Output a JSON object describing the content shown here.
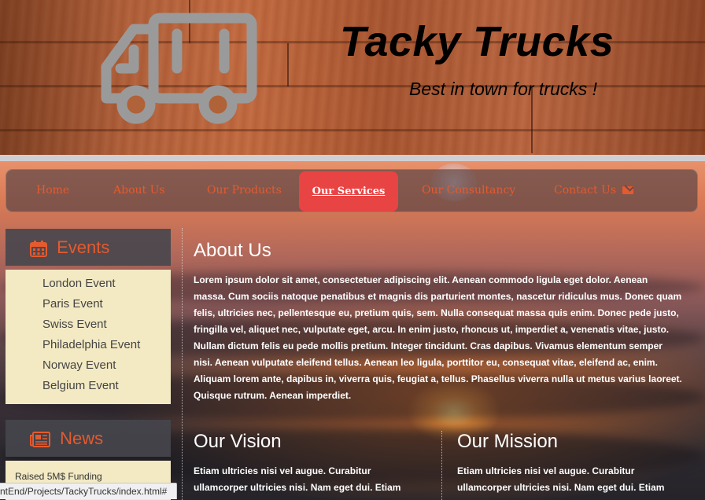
{
  "header": {
    "title": "Tacky Trucks",
    "tagline": "Best in town for trucks !",
    "logo_icon": "truck-icon"
  },
  "nav": {
    "items": [
      {
        "label": "Home"
      },
      {
        "label": "About Us"
      },
      {
        "label": "Our Products"
      },
      {
        "label": "Our Services",
        "active": true
      },
      {
        "label": "Our Consultancy"
      },
      {
        "label": "Contact Us",
        "icon": "envelope-icon"
      }
    ],
    "accent_color": "#e55a2e",
    "active_bg_color": "#e84444"
  },
  "sidebar": {
    "events": {
      "title": "Events",
      "icon": "calendar-icon",
      "items": [
        "London Event",
        "Paris Event",
        "Swiss Event",
        "Philadelphia Event",
        "Norway Event",
        "Belgium Event"
      ]
    },
    "news": {
      "title": "News",
      "icon": "newspaper-icon",
      "items": [
        "Raised 5M$ Funding"
      ]
    }
  },
  "main": {
    "about": {
      "heading": "About Us",
      "lines": [
        "Lorem ipsum dolor sit amet, consectetuer adipiscing elit. Aenean commodo ligula eget dolor. Aenean",
        "massa. Cum sociis natoque penatibus et magnis dis parturient montes, nascetur ridiculus mus. Donec quam",
        "felis, ultricies nec, pellentesque eu, pretium quis, sem. Nulla consequat massa quis enim. Donec pede justo,",
        "fringilla vel, aliquet nec, vulputate eget, arcu. In enim justo, rhoncus ut, imperdiet a, venenatis vitae, justo.",
        "Nullam dictum felis eu pede mollis pretium. Integer tincidunt. Cras dapibus. Vivamus elementum semper",
        "nisi. Aenean vulputate eleifend tellus. Aenean leo ligula, porttitor eu, consequat vitae, eleifend ac, enim.",
        "Aliquam lorem ante, dapibus in, viverra quis, feugiat a, tellus. Phasellus viverra nulla ut metus varius laoreet.",
        "Quisque rutrum. Aenean imperdiet."
      ]
    },
    "vision": {
      "heading": "Our Vision",
      "lines": [
        "Etiam ultricies nisi vel augue. Curabitur",
        "ullamcorper ultricies nisi. Nam eget dui. Etiam"
      ]
    },
    "mission": {
      "heading": "Our Mission",
      "lines": [
        "Etiam ultricies nisi vel augue. Curabitur",
        "ullamcorper ultricies nisi. Nam eget dui. Etiam"
      ]
    }
  },
  "statusbar": {
    "url": "ntEnd/Projects/TackyTrucks/index.html#"
  }
}
